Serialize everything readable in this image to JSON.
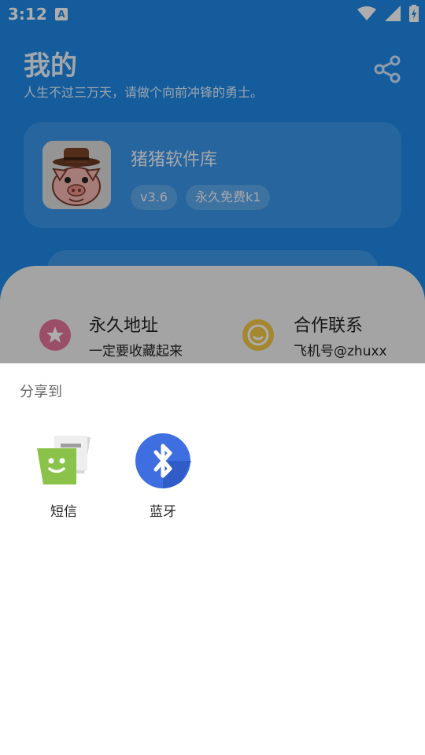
{
  "status_bar": {
    "time": "3:12",
    "notification_badge": "A"
  },
  "header": {
    "title": "我的",
    "subtitle": "人生不过三万天，请做个向前冲锋的勇士。",
    "share_icon": "share-icon"
  },
  "profile_card": {
    "app_name": "猪猪软件库",
    "version_badge": "v3.6",
    "license_badge": "永久免费k1"
  },
  "links": [
    {
      "title": "永久地址",
      "subtitle": "一定要收藏起来",
      "icon": "star-icon"
    },
    {
      "title": "合作联系",
      "subtitle": "飞机号@zhuxx",
      "icon": "smile-icon"
    }
  ],
  "share_sheet": {
    "title": "分享到",
    "targets": [
      {
        "label": "短信",
        "icon": "messaging-icon"
      },
      {
        "label": "蓝牙",
        "icon": "bluetooth-icon"
      }
    ]
  },
  "colors": {
    "primary": "#1e88e5",
    "sms_green": "#8bc34a",
    "bluetooth_blue": "#3f6ee0"
  }
}
